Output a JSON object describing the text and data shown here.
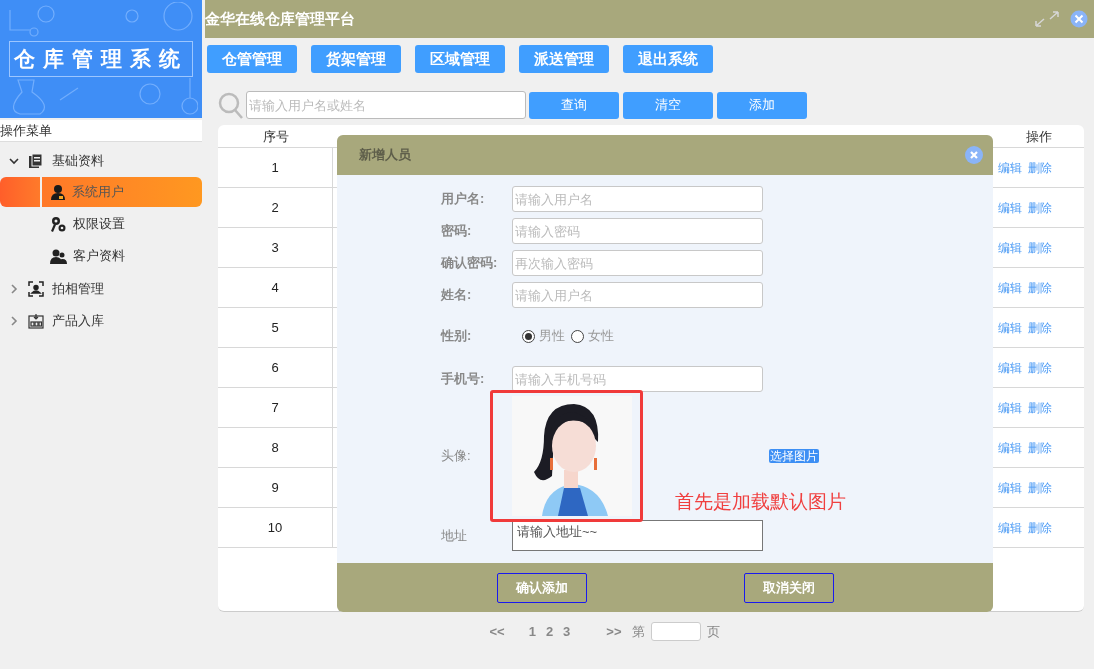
{
  "sidebar": {
    "logo": "仓库管理系统",
    "menu_title": "操作菜单",
    "items": [
      {
        "label": "基础资料",
        "expanded": true,
        "children": [
          {
            "label": "系统用户",
            "selected": true
          },
          {
            "label": "权限设置",
            "selected": false
          },
          {
            "label": "客户资料",
            "selected": false
          }
        ]
      },
      {
        "label": "拍相管理",
        "expanded": false
      },
      {
        "label": "产品入库",
        "expanded": false
      }
    ]
  },
  "header": {
    "title": "金华在线仓库管理平台"
  },
  "nav": [
    "仓管管理",
    "货架管理",
    "区域管理",
    "派送管理",
    "退出系统"
  ],
  "search": {
    "placeholder": "请输入用户名或姓名",
    "buttons": [
      "查询",
      "清空",
      "添加"
    ]
  },
  "table": {
    "columns": [
      "序号",
      "操作"
    ],
    "rows": [
      {
        "index": "1",
        "actions": [
          "编辑",
          "删除"
        ]
      },
      {
        "index": "2",
        "actions": [
          "编辑",
          "删除"
        ]
      },
      {
        "index": "3",
        "actions": [
          "编辑",
          "删除"
        ]
      },
      {
        "index": "4",
        "actions": [
          "编辑",
          "删除"
        ]
      },
      {
        "index": "5",
        "actions": [
          "编辑",
          "删除"
        ]
      },
      {
        "index": "6",
        "actions": [
          "编辑",
          "删除"
        ]
      },
      {
        "index": "7",
        "actions": [
          "编辑",
          "删除"
        ]
      },
      {
        "index": "8",
        "actions": [
          "编辑",
          "删除"
        ]
      },
      {
        "index": "9",
        "actions": [
          "编辑",
          "删除"
        ]
      },
      {
        "index": "10",
        "actions": [
          "编辑",
          "删除"
        ]
      }
    ]
  },
  "dialog": {
    "title": "新增人员",
    "fields": [
      {
        "kind": "text",
        "label": "用户名:",
        "placeholder": "请输入用户名"
      },
      {
        "kind": "text",
        "label": "密码:",
        "placeholder": "请输入密码"
      },
      {
        "kind": "text",
        "label": "确认密码:",
        "placeholder": "再次输入密码"
      },
      {
        "kind": "text",
        "label": "姓名:",
        "placeholder": "请输入用户名"
      },
      {
        "kind": "radio",
        "label": "性别:",
        "options": [
          {
            "label": "男性",
            "selected": true
          },
          {
            "label": "女性",
            "selected": false
          }
        ]
      },
      {
        "kind": "text",
        "label": "手机号:",
        "placeholder": "请输入手机号码"
      },
      {
        "kind": "avatar",
        "label": "头像:",
        "button": "选择图片"
      },
      {
        "kind": "textarea",
        "label": "地址",
        "placeholder": "请输入地址~~"
      }
    ],
    "buttons": [
      "确认添加",
      "取消关闭"
    ],
    "annotation": "首先是加载默认图片"
  },
  "pagination": {
    "prev": "<<",
    "pages": [
      "1",
      "2",
      "3"
    ],
    "next": ">>",
    "goto_prefix": "第",
    "goto_suffix": "页"
  }
}
